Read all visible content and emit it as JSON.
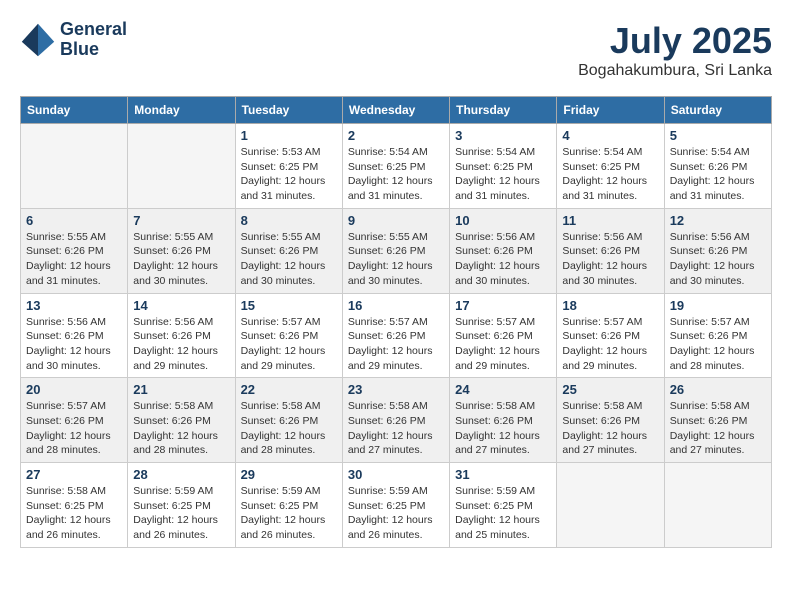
{
  "header": {
    "logo_line1": "General",
    "logo_line2": "Blue",
    "month": "July 2025",
    "location": "Bogahakumbura, Sri Lanka"
  },
  "days_of_week": [
    "Sunday",
    "Monday",
    "Tuesday",
    "Wednesday",
    "Thursday",
    "Friday",
    "Saturday"
  ],
  "weeks": [
    [
      {
        "day": "",
        "info": ""
      },
      {
        "day": "",
        "info": ""
      },
      {
        "day": "1",
        "info": "Sunrise: 5:53 AM\nSunset: 6:25 PM\nDaylight: 12 hours\nand 31 minutes."
      },
      {
        "day": "2",
        "info": "Sunrise: 5:54 AM\nSunset: 6:25 PM\nDaylight: 12 hours\nand 31 minutes."
      },
      {
        "day": "3",
        "info": "Sunrise: 5:54 AM\nSunset: 6:25 PM\nDaylight: 12 hours\nand 31 minutes."
      },
      {
        "day": "4",
        "info": "Sunrise: 5:54 AM\nSunset: 6:25 PM\nDaylight: 12 hours\nand 31 minutes."
      },
      {
        "day": "5",
        "info": "Sunrise: 5:54 AM\nSunset: 6:26 PM\nDaylight: 12 hours\nand 31 minutes."
      }
    ],
    [
      {
        "day": "6",
        "info": "Sunrise: 5:55 AM\nSunset: 6:26 PM\nDaylight: 12 hours\nand 31 minutes."
      },
      {
        "day": "7",
        "info": "Sunrise: 5:55 AM\nSunset: 6:26 PM\nDaylight: 12 hours\nand 30 minutes."
      },
      {
        "day": "8",
        "info": "Sunrise: 5:55 AM\nSunset: 6:26 PM\nDaylight: 12 hours\nand 30 minutes."
      },
      {
        "day": "9",
        "info": "Sunrise: 5:55 AM\nSunset: 6:26 PM\nDaylight: 12 hours\nand 30 minutes."
      },
      {
        "day": "10",
        "info": "Sunrise: 5:56 AM\nSunset: 6:26 PM\nDaylight: 12 hours\nand 30 minutes."
      },
      {
        "day": "11",
        "info": "Sunrise: 5:56 AM\nSunset: 6:26 PM\nDaylight: 12 hours\nand 30 minutes."
      },
      {
        "day": "12",
        "info": "Sunrise: 5:56 AM\nSunset: 6:26 PM\nDaylight: 12 hours\nand 30 minutes."
      }
    ],
    [
      {
        "day": "13",
        "info": "Sunrise: 5:56 AM\nSunset: 6:26 PM\nDaylight: 12 hours\nand 30 minutes."
      },
      {
        "day": "14",
        "info": "Sunrise: 5:56 AM\nSunset: 6:26 PM\nDaylight: 12 hours\nand 29 minutes."
      },
      {
        "day": "15",
        "info": "Sunrise: 5:57 AM\nSunset: 6:26 PM\nDaylight: 12 hours\nand 29 minutes."
      },
      {
        "day": "16",
        "info": "Sunrise: 5:57 AM\nSunset: 6:26 PM\nDaylight: 12 hours\nand 29 minutes."
      },
      {
        "day": "17",
        "info": "Sunrise: 5:57 AM\nSunset: 6:26 PM\nDaylight: 12 hours\nand 29 minutes."
      },
      {
        "day": "18",
        "info": "Sunrise: 5:57 AM\nSunset: 6:26 PM\nDaylight: 12 hours\nand 29 minutes."
      },
      {
        "day": "19",
        "info": "Sunrise: 5:57 AM\nSunset: 6:26 PM\nDaylight: 12 hours\nand 28 minutes."
      }
    ],
    [
      {
        "day": "20",
        "info": "Sunrise: 5:57 AM\nSunset: 6:26 PM\nDaylight: 12 hours\nand 28 minutes."
      },
      {
        "day": "21",
        "info": "Sunrise: 5:58 AM\nSunset: 6:26 PM\nDaylight: 12 hours\nand 28 minutes."
      },
      {
        "day": "22",
        "info": "Sunrise: 5:58 AM\nSunset: 6:26 PM\nDaylight: 12 hours\nand 28 minutes."
      },
      {
        "day": "23",
        "info": "Sunrise: 5:58 AM\nSunset: 6:26 PM\nDaylight: 12 hours\nand 27 minutes."
      },
      {
        "day": "24",
        "info": "Sunrise: 5:58 AM\nSunset: 6:26 PM\nDaylight: 12 hours\nand 27 minutes."
      },
      {
        "day": "25",
        "info": "Sunrise: 5:58 AM\nSunset: 6:26 PM\nDaylight: 12 hours\nand 27 minutes."
      },
      {
        "day": "26",
        "info": "Sunrise: 5:58 AM\nSunset: 6:26 PM\nDaylight: 12 hours\nand 27 minutes."
      }
    ],
    [
      {
        "day": "27",
        "info": "Sunrise: 5:58 AM\nSunset: 6:25 PM\nDaylight: 12 hours\nand 26 minutes."
      },
      {
        "day": "28",
        "info": "Sunrise: 5:59 AM\nSunset: 6:25 PM\nDaylight: 12 hours\nand 26 minutes."
      },
      {
        "day": "29",
        "info": "Sunrise: 5:59 AM\nSunset: 6:25 PM\nDaylight: 12 hours\nand 26 minutes."
      },
      {
        "day": "30",
        "info": "Sunrise: 5:59 AM\nSunset: 6:25 PM\nDaylight: 12 hours\nand 26 minutes."
      },
      {
        "day": "31",
        "info": "Sunrise: 5:59 AM\nSunset: 6:25 PM\nDaylight: 12 hours\nand 25 minutes."
      },
      {
        "day": "",
        "info": ""
      },
      {
        "day": "",
        "info": ""
      }
    ]
  ]
}
